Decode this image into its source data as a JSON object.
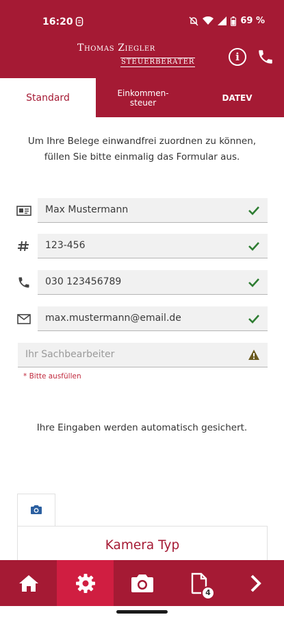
{
  "status_bar": {
    "time": "16:20",
    "battery": "69 %"
  },
  "header": {
    "brand_name": "Thomas Ziegler",
    "brand_subtitle": "STEUERBERATER",
    "info_icon": "info-icon",
    "phone_icon": "phone-icon"
  },
  "tabs": [
    {
      "label": "Standard",
      "active": true
    },
    {
      "label": "Einkommen-\nsteuer",
      "active": false
    },
    {
      "label": "DATEV",
      "active": false
    }
  ],
  "intro_text": "Um Ihre Belege einwandfrei zuordnen zu können, füllen Sie bitte einmalig das Formular aus.",
  "form": {
    "name": {
      "value": "Max Mustermann",
      "icon": "id-card-icon",
      "status": "valid"
    },
    "number": {
      "value": "123-456",
      "icon": "hash-icon",
      "status": "valid"
    },
    "phone": {
      "value": "030 123456789",
      "icon": "phone-icon",
      "status": "valid"
    },
    "email": {
      "value": "max.mustermann@email.de",
      "icon": "envelope-icon",
      "status": "valid"
    },
    "agent": {
      "placeholder": "Ihr Sachbearbeiter",
      "status": "warning",
      "hint": "* Bitte ausfüllen"
    }
  },
  "autosave_text": "Ihre Eingaben werden automatisch gesichert.",
  "camera": {
    "tab_icon": "camera-icon",
    "title": "Kamera Typ"
  },
  "bottom_nav": {
    "items": [
      {
        "icon": "home-icon",
        "active": false
      },
      {
        "icon": "gear-icon",
        "active": true
      },
      {
        "icon": "camera-icon",
        "active": false
      },
      {
        "icon": "document-icon",
        "active": false,
        "badge": "4"
      },
      {
        "icon": "chevron-right-icon",
        "active": false
      }
    ]
  },
  "colors": {
    "brand": "#a51a34",
    "active_nav": "#d01e41",
    "valid": "#2e7d32",
    "warning": "#6b5a1e",
    "hint": "#c0293d"
  }
}
